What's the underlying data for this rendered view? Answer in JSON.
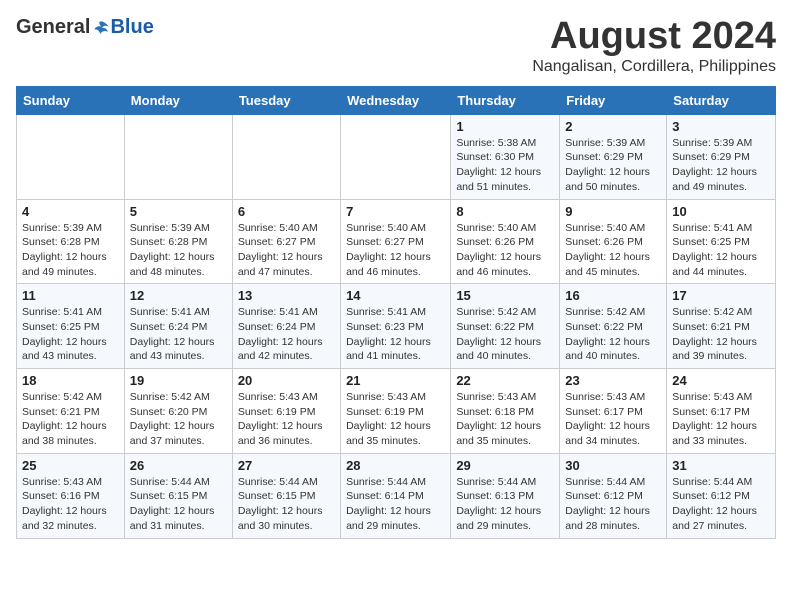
{
  "logo": {
    "general": "General",
    "blue": "Blue"
  },
  "title": "August 2024",
  "location": "Nangalisan, Cordillera, Philippines",
  "weekdays": [
    "Sunday",
    "Monday",
    "Tuesday",
    "Wednesday",
    "Thursday",
    "Friday",
    "Saturday"
  ],
  "weeks": [
    [
      {
        "day": "",
        "info": ""
      },
      {
        "day": "",
        "info": ""
      },
      {
        "day": "",
        "info": ""
      },
      {
        "day": "",
        "info": ""
      },
      {
        "day": "1",
        "info": "Sunrise: 5:38 AM\nSunset: 6:30 PM\nDaylight: 12 hours\nand 51 minutes."
      },
      {
        "day": "2",
        "info": "Sunrise: 5:39 AM\nSunset: 6:29 PM\nDaylight: 12 hours\nand 50 minutes."
      },
      {
        "day": "3",
        "info": "Sunrise: 5:39 AM\nSunset: 6:29 PM\nDaylight: 12 hours\nand 49 minutes."
      }
    ],
    [
      {
        "day": "4",
        "info": "Sunrise: 5:39 AM\nSunset: 6:28 PM\nDaylight: 12 hours\nand 49 minutes."
      },
      {
        "day": "5",
        "info": "Sunrise: 5:39 AM\nSunset: 6:28 PM\nDaylight: 12 hours\nand 48 minutes."
      },
      {
        "day": "6",
        "info": "Sunrise: 5:40 AM\nSunset: 6:27 PM\nDaylight: 12 hours\nand 47 minutes."
      },
      {
        "day": "7",
        "info": "Sunrise: 5:40 AM\nSunset: 6:27 PM\nDaylight: 12 hours\nand 46 minutes."
      },
      {
        "day": "8",
        "info": "Sunrise: 5:40 AM\nSunset: 6:26 PM\nDaylight: 12 hours\nand 46 minutes."
      },
      {
        "day": "9",
        "info": "Sunrise: 5:40 AM\nSunset: 6:26 PM\nDaylight: 12 hours\nand 45 minutes."
      },
      {
        "day": "10",
        "info": "Sunrise: 5:41 AM\nSunset: 6:25 PM\nDaylight: 12 hours\nand 44 minutes."
      }
    ],
    [
      {
        "day": "11",
        "info": "Sunrise: 5:41 AM\nSunset: 6:25 PM\nDaylight: 12 hours\nand 43 minutes."
      },
      {
        "day": "12",
        "info": "Sunrise: 5:41 AM\nSunset: 6:24 PM\nDaylight: 12 hours\nand 43 minutes."
      },
      {
        "day": "13",
        "info": "Sunrise: 5:41 AM\nSunset: 6:24 PM\nDaylight: 12 hours\nand 42 minutes."
      },
      {
        "day": "14",
        "info": "Sunrise: 5:41 AM\nSunset: 6:23 PM\nDaylight: 12 hours\nand 41 minutes."
      },
      {
        "day": "15",
        "info": "Sunrise: 5:42 AM\nSunset: 6:22 PM\nDaylight: 12 hours\nand 40 minutes."
      },
      {
        "day": "16",
        "info": "Sunrise: 5:42 AM\nSunset: 6:22 PM\nDaylight: 12 hours\nand 40 minutes."
      },
      {
        "day": "17",
        "info": "Sunrise: 5:42 AM\nSunset: 6:21 PM\nDaylight: 12 hours\nand 39 minutes."
      }
    ],
    [
      {
        "day": "18",
        "info": "Sunrise: 5:42 AM\nSunset: 6:21 PM\nDaylight: 12 hours\nand 38 minutes."
      },
      {
        "day": "19",
        "info": "Sunrise: 5:42 AM\nSunset: 6:20 PM\nDaylight: 12 hours\nand 37 minutes."
      },
      {
        "day": "20",
        "info": "Sunrise: 5:43 AM\nSunset: 6:19 PM\nDaylight: 12 hours\nand 36 minutes."
      },
      {
        "day": "21",
        "info": "Sunrise: 5:43 AM\nSunset: 6:19 PM\nDaylight: 12 hours\nand 35 minutes."
      },
      {
        "day": "22",
        "info": "Sunrise: 5:43 AM\nSunset: 6:18 PM\nDaylight: 12 hours\nand 35 minutes."
      },
      {
        "day": "23",
        "info": "Sunrise: 5:43 AM\nSunset: 6:17 PM\nDaylight: 12 hours\nand 34 minutes."
      },
      {
        "day": "24",
        "info": "Sunrise: 5:43 AM\nSunset: 6:17 PM\nDaylight: 12 hours\nand 33 minutes."
      }
    ],
    [
      {
        "day": "25",
        "info": "Sunrise: 5:43 AM\nSunset: 6:16 PM\nDaylight: 12 hours\nand 32 minutes."
      },
      {
        "day": "26",
        "info": "Sunrise: 5:44 AM\nSunset: 6:15 PM\nDaylight: 12 hours\nand 31 minutes."
      },
      {
        "day": "27",
        "info": "Sunrise: 5:44 AM\nSunset: 6:15 PM\nDaylight: 12 hours\nand 30 minutes."
      },
      {
        "day": "28",
        "info": "Sunrise: 5:44 AM\nSunset: 6:14 PM\nDaylight: 12 hours\nand 29 minutes."
      },
      {
        "day": "29",
        "info": "Sunrise: 5:44 AM\nSunset: 6:13 PM\nDaylight: 12 hours\nand 29 minutes."
      },
      {
        "day": "30",
        "info": "Sunrise: 5:44 AM\nSunset: 6:12 PM\nDaylight: 12 hours\nand 28 minutes."
      },
      {
        "day": "31",
        "info": "Sunrise: 5:44 AM\nSunset: 6:12 PM\nDaylight: 12 hours\nand 27 minutes."
      }
    ]
  ]
}
